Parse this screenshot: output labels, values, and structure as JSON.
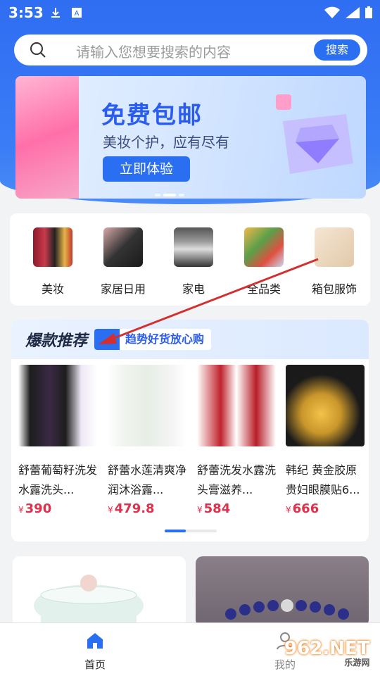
{
  "status_bar": {
    "time": "3:53"
  },
  "search": {
    "placeholder": "请输入您想要搜索的内容",
    "button_label": "搜索"
  },
  "banner": {
    "title": "免费包邮",
    "subtitle": "美妆个护，应有尽有",
    "cta_label": "立即体验"
  },
  "categories": [
    {
      "label": "美妆",
      "icon": "cosmetics-icon"
    },
    {
      "label": "家居日用",
      "icon": "umbrella-icon"
    },
    {
      "label": "家电",
      "icon": "range-hood-icon"
    },
    {
      "label": "全品类",
      "icon": "groceries-icon"
    },
    {
      "label": "箱包服饰",
      "icon": "bag-icon"
    }
  ],
  "hot": {
    "title": "爆款推荐",
    "badge": "趋势好货放心购",
    "products": [
      {
        "name": "舒蕾葡萄籽洗发水露洗头...",
        "currency": "¥",
        "price": "390"
      },
      {
        "name": "舒蕾水莲清爽净润沐浴露...",
        "currency": "¥",
        "price": "479.8"
      },
      {
        "name": "舒蕾洗发水露洗头膏滋养...",
        "currency": "¥",
        "price": "584"
      },
      {
        "name": "韩纪 黄金胶原贵妇眼膜贴6...",
        "currency": "¥",
        "price": "666"
      }
    ]
  },
  "tabbar": {
    "home_label": "首页",
    "me_label": "我的"
  },
  "watermark": {
    "text": "962.NET",
    "sub": "乐游网"
  },
  "colors": {
    "primary": "#2a6ff2",
    "price": "#e1304b",
    "annotation_arrow": "#d32f2f"
  }
}
